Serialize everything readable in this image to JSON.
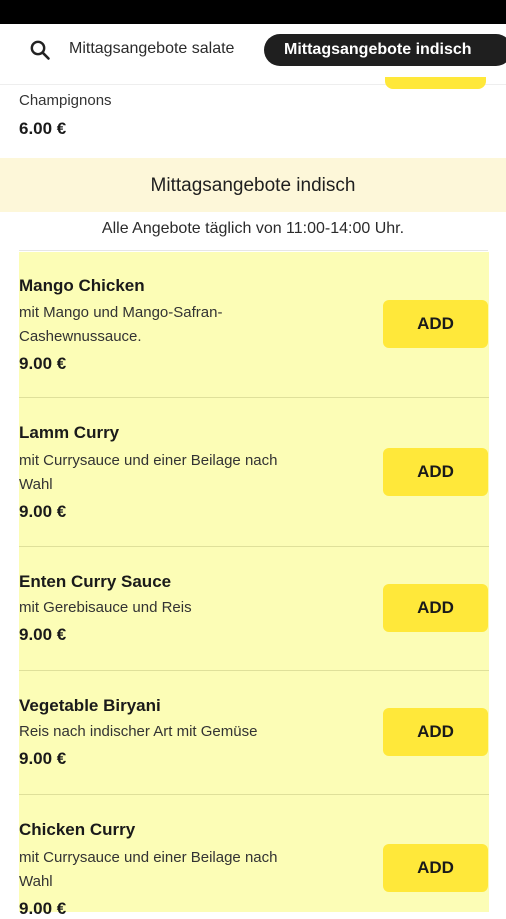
{
  "tabs": {
    "search_icon": "search-icon",
    "items": [
      {
        "label": "Mittagsangebote salate",
        "active": false
      },
      {
        "label": "Mittagsangebote indisch",
        "active": true
      }
    ]
  },
  "previous_item": {
    "description": "Champignons",
    "price": "6.00 €"
  },
  "section": {
    "title": "Mittagsangebote indisch",
    "note": "Alle Angebote täglich von 11:00-14:00 Uhr."
  },
  "add_label": "ADD",
  "items": [
    {
      "name": "Mango Chicken",
      "description": "mit Mango und Mango-Safran-Cashewnussauce.",
      "price": "9.00 €"
    },
    {
      "name": "Lamm Curry",
      "description": "mit Currysauce und einer Beilage nach Wahl",
      "price": "9.00 €"
    },
    {
      "name": "Enten Curry Sauce",
      "description": "mit Gerebisauce und Reis",
      "price": "9.00 €"
    },
    {
      "name": "Vegetable Biryani",
      "description": "Reis nach indischer Art mit Gemüse",
      "price": "9.00 €"
    },
    {
      "name": "Chicken Curry",
      "description": "mit Currysauce und einer Beilage nach Wahl",
      "price": "9.00 €"
    }
  ],
  "colors": {
    "accent": "#ffe83a",
    "item_background": "#fcfdb6",
    "section_background": "#fdf7d9",
    "active_tab": "#1f1f1f"
  }
}
